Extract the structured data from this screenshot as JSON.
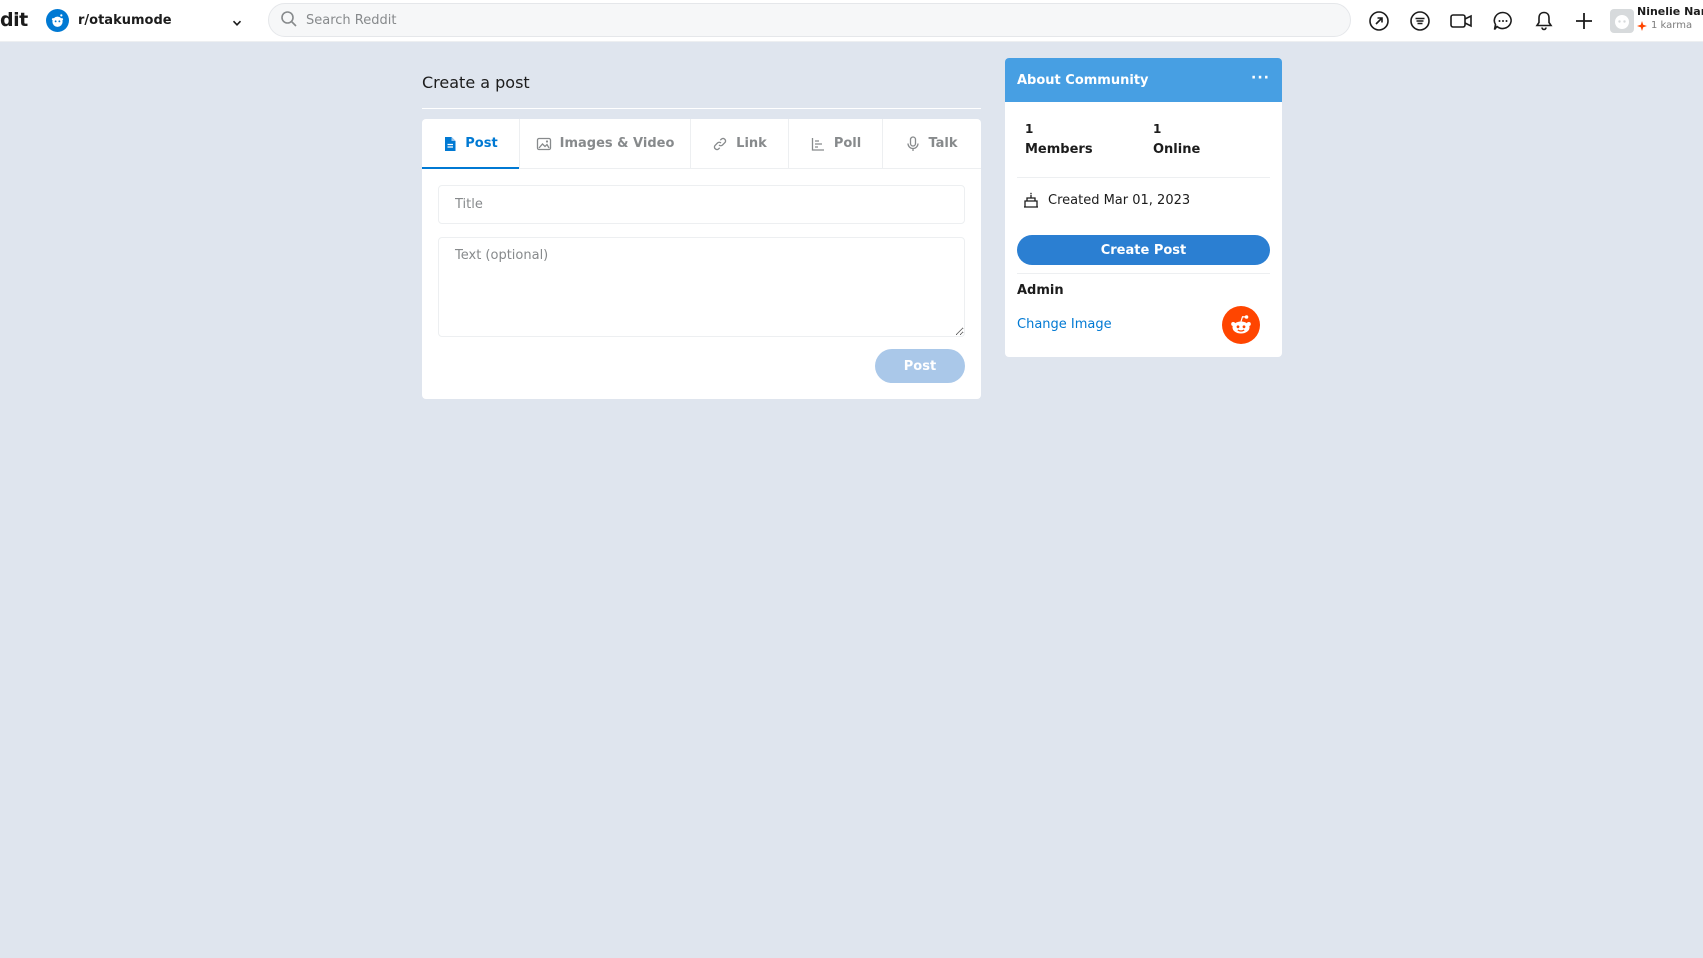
{
  "header": {
    "logo_fragment": "dit",
    "community": "r/otakumode",
    "search_placeholder": "Search Reddit",
    "user_name": "Ninelie Nana",
    "user_karma": "1 karma",
    "icons": [
      "popular-icon",
      "coin-icon",
      "video-icon",
      "chat-icon",
      "notification-bell-icon",
      "create-plus-icon"
    ]
  },
  "main": {
    "page_title": "Create a post",
    "tabs": [
      {
        "label": "Post",
        "icon": "document-icon",
        "active": true
      },
      {
        "label": "Images & Video",
        "icon": "image-icon",
        "active": false
      },
      {
        "label": "Link",
        "icon": "link-icon",
        "active": false
      },
      {
        "label": "Poll",
        "icon": "poll-icon",
        "active": false
      },
      {
        "label": "Talk",
        "icon": "microphone-icon",
        "active": false
      }
    ],
    "title_placeholder": "Title",
    "text_placeholder": "Text (optional)",
    "post_button": "Post"
  },
  "sidebar": {
    "heading": "About Community",
    "more": "···",
    "members_count": "1",
    "members_label": "Members",
    "online_count": "1",
    "online_label": "Online",
    "created": "Created Mar 01, 2023",
    "create_post_button": "Create Post",
    "admin_label": "Admin",
    "change_image": "Change Image"
  },
  "colors": {
    "accent": "#0079d3",
    "sidebar_header": "#479fe3",
    "post_button_disabled": "#aac8e9",
    "background": "#dfe5ee",
    "snoo_orange": "#ff4500"
  }
}
